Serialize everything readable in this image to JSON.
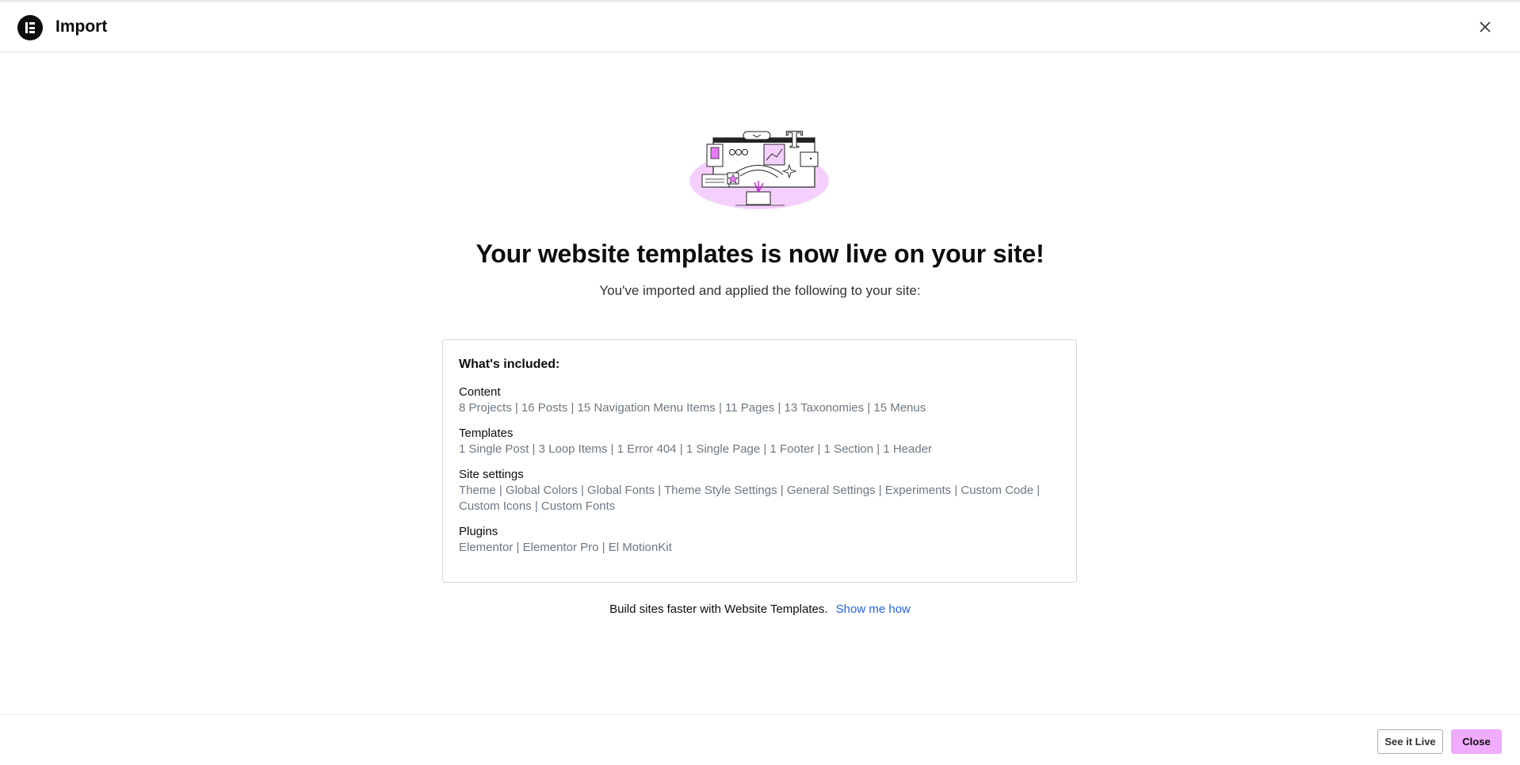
{
  "header": {
    "title": "Import",
    "logo_icon": "elementor-logo-icon",
    "close_icon": "close-icon"
  },
  "main": {
    "headline": "Your website templates is now live on your site!",
    "subline": "You've imported and applied the following to your site:",
    "card": {
      "title": "What's included:",
      "sections": [
        {
          "title": "Content",
          "body": "8 Projects | 16 Posts | 15 Navigation Menu Items | 11 Pages | 13 Taxonomies | 15 Menus"
        },
        {
          "title": "Templates",
          "body": "1 Single Post | 3 Loop Items | 1 Error 404 | 1 Single Page | 1 Footer | 1 Section | 1 Header"
        },
        {
          "title": "Site settings",
          "body": "Theme | Global Colors | Global Fonts | Theme Style Settings | General Settings | Experiments | Custom Code | Custom Icons | Custom Fonts"
        },
        {
          "title": "Plugins",
          "body": "Elementor | Elementor Pro | El MotionKit"
        }
      ]
    },
    "footer_note": {
      "text": "Build sites faster with Website Templates.",
      "link": "Show me how"
    }
  },
  "footer": {
    "see_live_label": "See it Live",
    "close_label": "Close"
  },
  "colors": {
    "accent_button": "#f0abfc",
    "link": "#2563eb",
    "muted_text": "#6d7882",
    "illustration_blob": "#f5d0fe"
  }
}
